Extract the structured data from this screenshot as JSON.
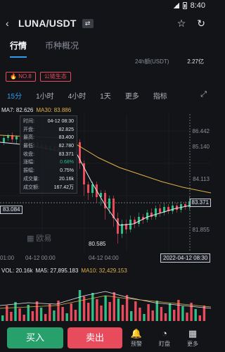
{
  "status": {
    "time": "8:40"
  },
  "header": {
    "pair": "LUNA/USDT",
    "swap_icon": "⇄"
  },
  "tabs": [
    {
      "label": "行情"
    },
    {
      "label": "币种概况"
    }
  ],
  "volume_24h": {
    "label": "24h额(USDT)",
    "value": "2.27亿"
  },
  "tags": {
    "rank": "NO.8",
    "eco": "公链生态"
  },
  "intervals": [
    "15分",
    "1小时",
    "4小时",
    "1天",
    "更多",
    "指标"
  ],
  "ma": {
    "ma7": "MA7: 82.626",
    "ma30": "MA30: 83.886"
  },
  "tooltip": [
    {
      "label": "时间:",
      "value": "04-12 08:30"
    },
    {
      "label": "开盘:",
      "value": "82.825"
    },
    {
      "label": "最高:",
      "value": "83.400"
    },
    {
      "label": "最低:",
      "value": "82.780"
    },
    {
      "label": "收盘:",
      "value": "83.371"
    },
    {
      "label": "涨幅:",
      "value": "0.68%"
    },
    {
      "label": "振幅:",
      "value": "0.75%"
    },
    {
      "label": "成交量:",
      "value": "20.16k"
    },
    {
      "label": "成交额:",
      "value": "167.42万"
    }
  ],
  "yaxis": {
    "top": "86.442",
    "a": "85.140",
    "b": "84.113",
    "c": "83.371",
    "d": "81.855",
    "e": "80.585"
  },
  "price_left": "83.084",
  "price_right": "83.371",
  "low_label": "80.585",
  "xaxis": {
    "t1": "01:00",
    "t2": "04-12 00:00",
    "t3": "04-12 04:00",
    "hl": "2022-04-12 08:30"
  },
  "watermark": "欧易",
  "vol": {
    "v": "VOL: 20.16k",
    "m5": "MA5: 27,895.183",
    "m10": "MA10: 32,429.153"
  },
  "bottom": {
    "buy": "买入",
    "sell": "卖出",
    "alert": "预警",
    "watch": "盯盘",
    "more": "更多"
  },
  "chart_data": {
    "type": "candlestick",
    "interval": "15分",
    "current": 83.371,
    "colors": {
      "up": "#2ebd85",
      "down": "#e84b5c",
      "ma30": "#e0b14a",
      "ma7": "#e6e8ec"
    }
  }
}
